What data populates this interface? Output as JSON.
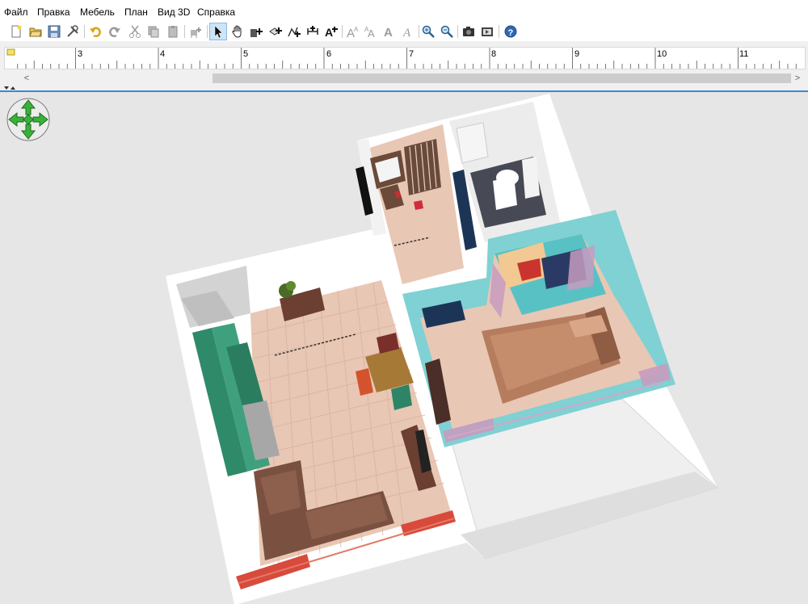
{
  "menu": {
    "items": [
      {
        "label": "Файл"
      },
      {
        "label": "Правка"
      },
      {
        "label": "Мебель"
      },
      {
        "label": "План"
      },
      {
        "label": "Вид 3D"
      },
      {
        "label": "Справка"
      }
    ]
  },
  "toolbar": {
    "buttons": [
      {
        "name": "new-home-icon"
      },
      {
        "name": "open-icon"
      },
      {
        "name": "save-icon"
      },
      {
        "name": "preferences-icon"
      },
      {
        "name": "undo-icon"
      },
      {
        "name": "redo-icon"
      },
      {
        "name": "cut-icon"
      },
      {
        "name": "copy-icon"
      },
      {
        "name": "paste-icon"
      },
      {
        "name": "add-furniture-icon"
      },
      {
        "name": "select-mode-icon"
      },
      {
        "name": "pan-mode-icon"
      },
      {
        "name": "create-walls-icon"
      },
      {
        "name": "create-rooms-icon"
      },
      {
        "name": "create-polylines-icon"
      },
      {
        "name": "create-dimensions-icon"
      },
      {
        "name": "add-text-icon"
      },
      {
        "name": "increase-text-size-icon"
      },
      {
        "name": "decrease-text-size-icon"
      },
      {
        "name": "bold-text-icon"
      },
      {
        "name": "italic-text-icon"
      },
      {
        "name": "zoom-in-icon"
      },
      {
        "name": "zoom-out-icon"
      },
      {
        "name": "create-photo-icon"
      },
      {
        "name": "create-video-icon"
      },
      {
        "name": "help-icon"
      }
    ],
    "selected": "select-mode-icon"
  },
  "ruler": {
    "labels": [
      "3",
      "4",
      "5",
      "6",
      "7",
      "8",
      "9",
      "10",
      "11"
    ]
  },
  "scroll": {
    "left_arrow": "<",
    "right_arrow": ">"
  },
  "view3d": {
    "background_color": "#e6e6e6",
    "wall_color": "#ffffff",
    "floor_color": "#e8c4b0",
    "accent_wall_color": "#7fd1d3",
    "navigation_icon": "navigation-arrows-icon"
  }
}
